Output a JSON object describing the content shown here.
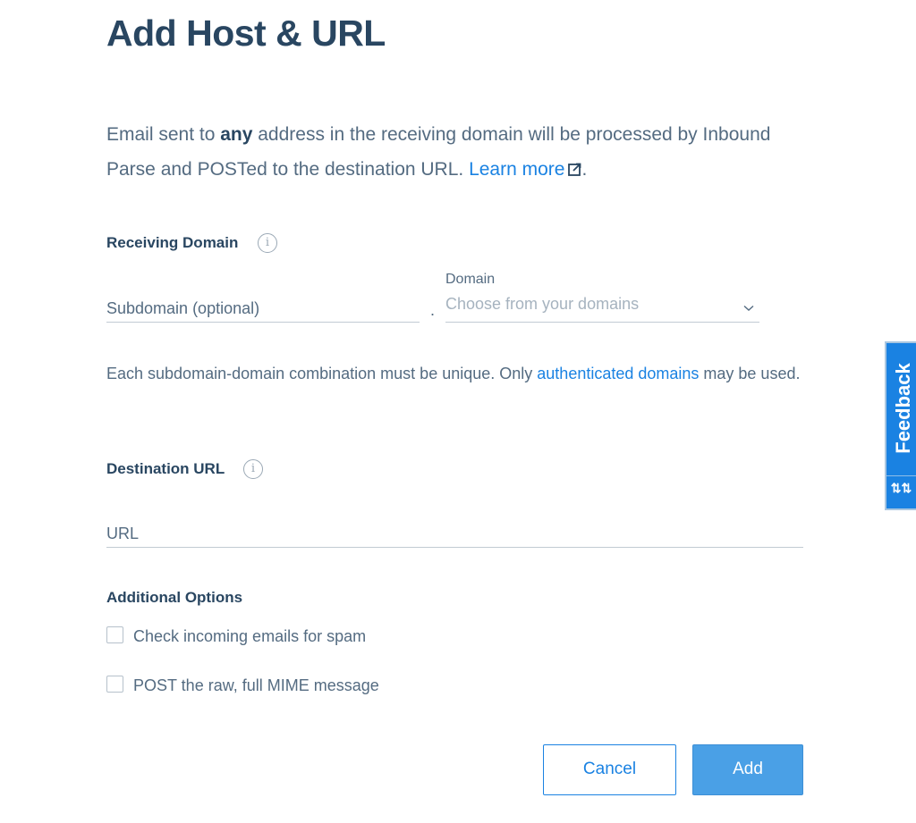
{
  "page": {
    "title": "Add Host & URL"
  },
  "intro": {
    "part1": "Email sent to ",
    "bold": "any",
    "part2": " address in the receiving domain will be processed by Inbound Parse and POSTed to the destination URL. ",
    "link": "Learn more",
    "end": "."
  },
  "receiving_domain": {
    "label": "Receiving Domain",
    "info_icon": "info-icon",
    "subdomain_placeholder": "Subdomain (optional)",
    "subdomain_value": "",
    "separator": ".",
    "domain_label": "Domain",
    "domain_placeholder": "Choose from your domains",
    "help_part1": "Each subdomain-domain combination must be unique. Only ",
    "help_link": "authenticated domains",
    "help_part2": " may be used."
  },
  "destination_url": {
    "label": "Destination URL",
    "info_icon": "info-icon",
    "placeholder": "URL",
    "value": ""
  },
  "additional_options": {
    "label": "Additional Options",
    "options": [
      {
        "label": "Check incoming emails for spam",
        "checked": false
      },
      {
        "label": "POST the raw, full MIME message",
        "checked": false
      }
    ]
  },
  "actions": {
    "cancel_label": "Cancel",
    "add_label": "Add"
  },
  "feedback": {
    "label": "Feedback",
    "arrows": "⇅⇅"
  },
  "colors": {
    "heading": "#294661",
    "body_text": "#546b81",
    "link": "#1a82e2",
    "add_button": "#4aa0e6",
    "feedback_tab": "#1a82e2"
  }
}
